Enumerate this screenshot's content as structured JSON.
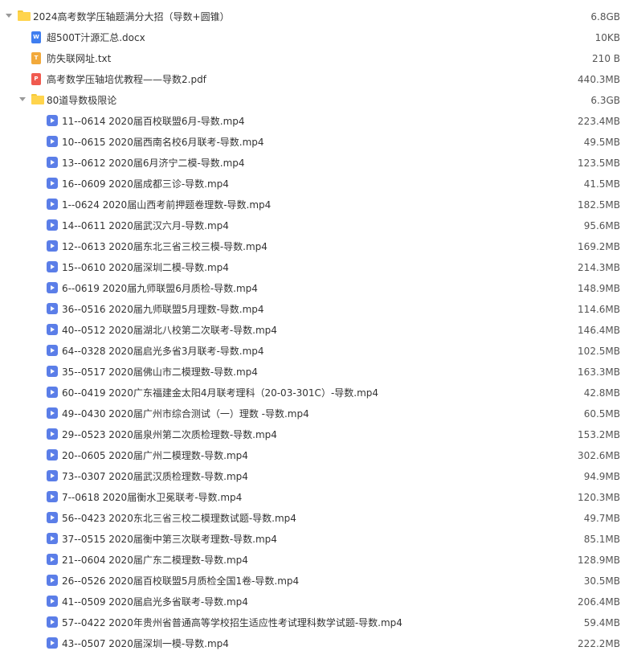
{
  "root": {
    "name": "2024高考数学压轴题满分大招（导数+圆锥）",
    "size": "6.8GB",
    "icon": "folder-icon"
  },
  "files": [
    {
      "name": "超500T汁源汇总.docx",
      "size": "10KB",
      "type": "doc",
      "icon": "docx-file-icon"
    },
    {
      "name": "防失联网址.txt",
      "size": "210 B",
      "type": "txt",
      "icon": "txt-file-icon"
    },
    {
      "name": "高考数学压轴培优教程——导数2.pdf",
      "size": "440.3MB",
      "type": "pdf",
      "icon": "pdf-file-icon"
    }
  ],
  "subfolder": {
    "name": "80道导数极限论",
    "size": "6.3GB",
    "icon": "folder-icon"
  },
  "videos": [
    {
      "name": "11--0614  2020届百校联盟6月-导数.mp4",
      "size": "223.4MB"
    },
    {
      "name": "10--0615  2020届西南名校6月联考-导数.mp4",
      "size": "49.5MB"
    },
    {
      "name": "13--0612  2020届6月济宁二模-导数.mp4",
      "size": "123.5MB"
    },
    {
      "name": "16--0609  2020届成都三诊-导数.mp4",
      "size": "41.5MB"
    },
    {
      "name": "1--0624  2020届山西考前押题卷理数-导数.mp4",
      "size": "182.5MB"
    },
    {
      "name": "14--0611  2020届武汉六月-导数.mp4",
      "size": "95.6MB"
    },
    {
      "name": "12--0613  2020届东北三省三校三模-导数.mp4",
      "size": "169.2MB"
    },
    {
      "name": "15--0610  2020届深圳二模-导数.mp4",
      "size": "214.3MB"
    },
    {
      "name": "6--0619  2020届九师联盟6月质检-导数.mp4",
      "size": "148.9MB"
    },
    {
      "name": "36--0516  2020届九师联盟5月理数-导数.mp4",
      "size": "114.6MB"
    },
    {
      "name": "40--0512  2020届湖北八校第二次联考-导数.mp4",
      "size": "146.4MB"
    },
    {
      "name": "64--0328  2020届启光多省3月联考-导数.mp4",
      "size": "102.5MB"
    },
    {
      "name": "35--0517  2020届佛山市二模理数-导数.mp4",
      "size": "163.3MB"
    },
    {
      "name": "60--0419  2020广东福建金太阳4月联考理科（20-03-301C）-导数.mp4",
      "size": "42.8MB"
    },
    {
      "name": "49--0430  2020届广州市综合测试（一）理数  -导数.mp4",
      "size": "60.5MB"
    },
    {
      "name": "29--0523  2020届泉州第二次质检理数-导数.mp4",
      "size": "153.2MB"
    },
    {
      "name": "20--0605  2020届广州二模理数-导数.mp4",
      "size": "302.6MB"
    },
    {
      "name": "73--0307  2020届武汉质检理数-导数.mp4",
      "size": "94.9MB"
    },
    {
      "name": "7--0618  2020届衡水卫冕联考-导数.mp4",
      "size": "120.3MB"
    },
    {
      "name": "56--0423  2020东北三省三校二模理数试题-导数.mp4",
      "size": "49.7MB"
    },
    {
      "name": "37--0515  2020届衡中第三次联考理数-导数.mp4",
      "size": "85.1MB"
    },
    {
      "name": "21--0604  2020届广东二模理数-导数.mp4",
      "size": "128.9MB"
    },
    {
      "name": "26--0526  2020届百校联盟5月质检全国1卷-导数.mp4",
      "size": "30.5MB"
    },
    {
      "name": "41--0509  2020届启光多省联考-导数.mp4",
      "size": "206.4MB"
    },
    {
      "name": "57--0422  2020年贵州省普通高等学校招生适应性考试理科数学试题-导数.mp4",
      "size": "59.4MB"
    },
    {
      "name": "43--0507  2020届深圳一模-导数.mp4",
      "size": "222.2MB"
    }
  ]
}
